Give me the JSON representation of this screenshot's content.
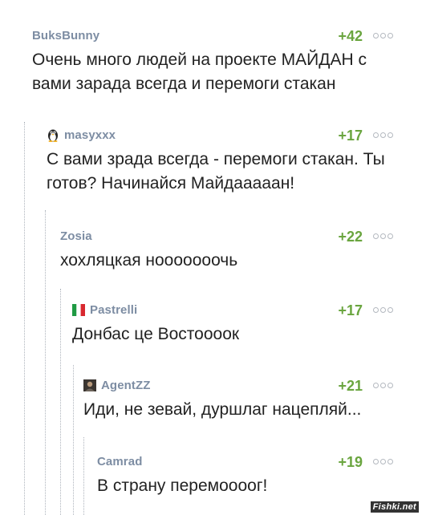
{
  "comments": [
    {
      "author": "BuksBunny",
      "score": "+42",
      "text": "Очень много людей на проекте МАЙДАН с вами зарада всегда и перемоги стакан"
    },
    {
      "author": "masyxxx",
      "score": "+17",
      "text": "С вами зрада всегда - перемоги стакан. Ты готов? Начинайся Майдааааан!",
      "icon": "penguin-avatar-icon"
    },
    {
      "author": "Zosia",
      "score": "+22",
      "text": "хохляцкая нооооооочь"
    },
    {
      "author": "Pastrelli",
      "score": "+17",
      "text": "Донбас це Востоооок",
      "icon": "italy-flag-icon"
    },
    {
      "author": "AgentZZ",
      "score": "+21",
      "text": "Иди, не зевай, дуршлаг нацепляй...",
      "icon": "user-avatar-icon"
    },
    {
      "author": "Camrad",
      "score": "+19",
      "text": "В страну перемоооог!"
    }
  ],
  "watermark": "Fishki.net",
  "colors": {
    "author": "#7d8da3",
    "score": "#6aa53f",
    "text": "#222222"
  }
}
